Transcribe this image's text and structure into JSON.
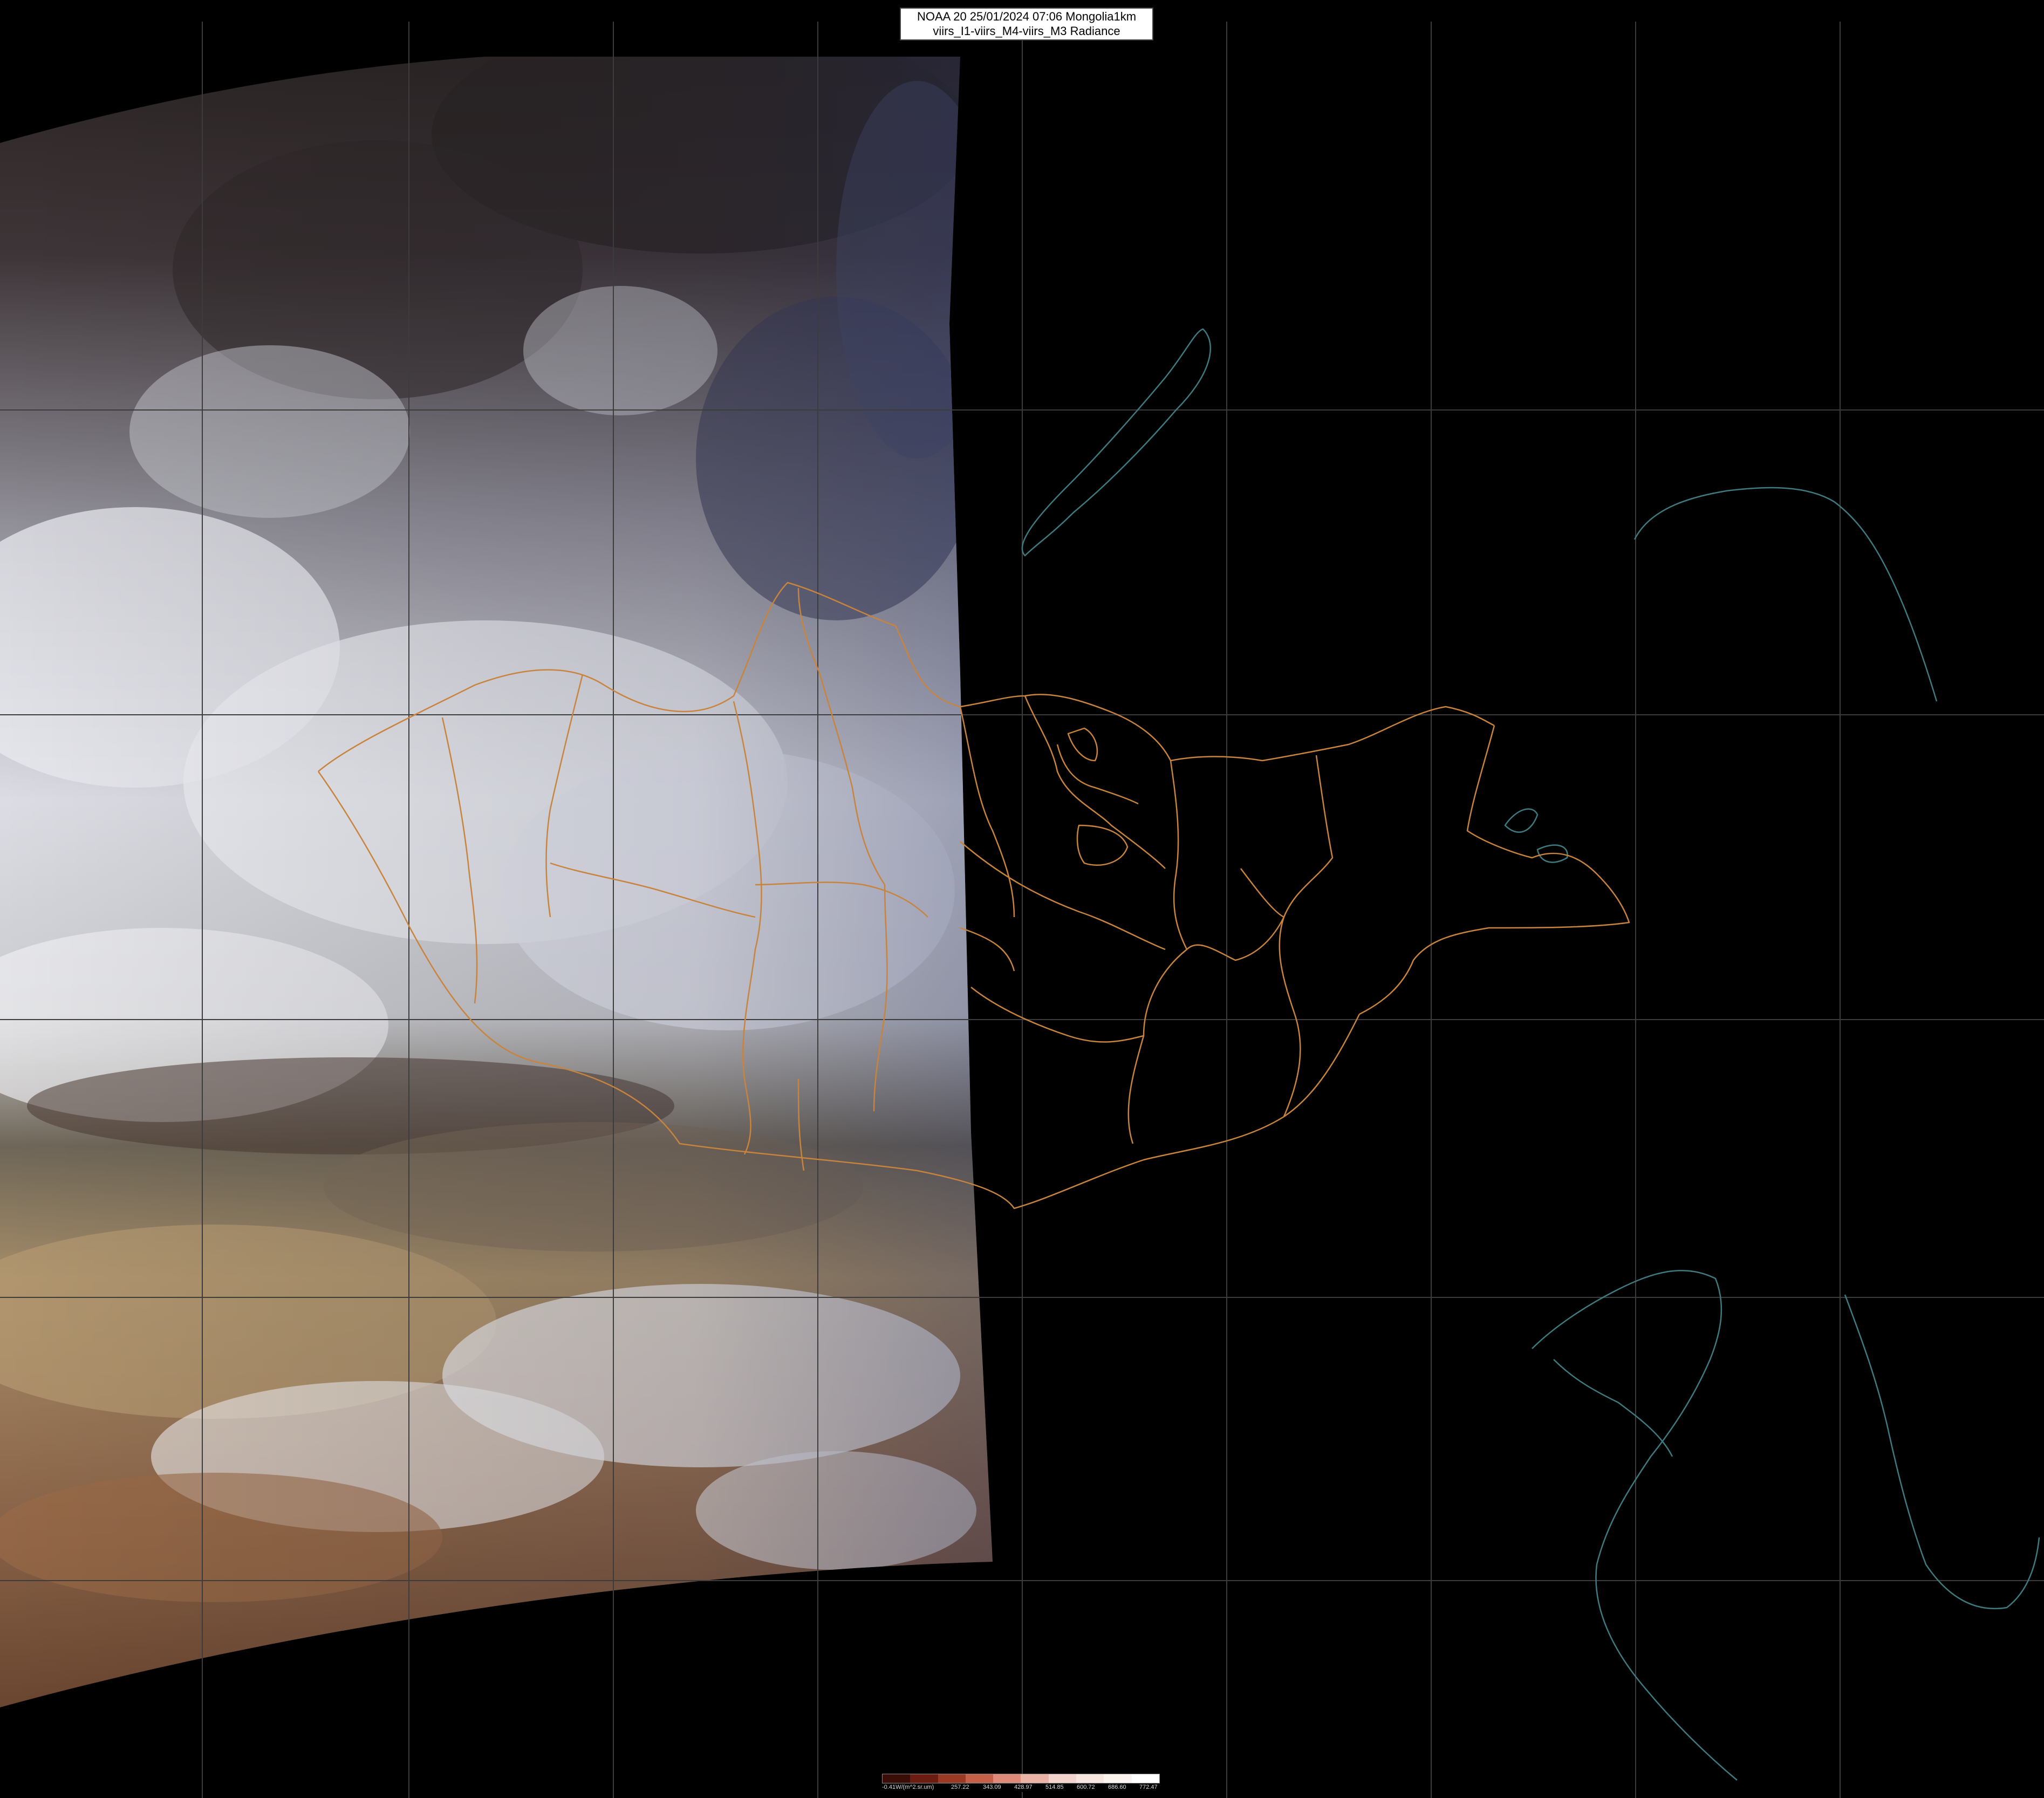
{
  "title": {
    "line1": "NOAA 20 25/01/2024 07:06 Mongolia1km",
    "line2": "viirs_I1-viirs_M4-viirs_M3 Radiance"
  },
  "legend": {
    "unit_label": "-0.41W/(m^2.sr.um)",
    "ticks": [
      "257.22",
      "343.09",
      "428.97",
      "514.85",
      "600.72",
      "686.60",
      "772.47"
    ],
    "colors": [
      "#3a0e06",
      "#6a1d10",
      "#9a3a25",
      "#c4604a",
      "#dd8a78",
      "#eab3a6",
      "#f3d4cc",
      "#f7e6e0",
      "#fbf3ef",
      "#ffffff"
    ]
  },
  "colors": {
    "background": "#000000",
    "grid": "#3c3c3c",
    "province_borders": "#c8843c",
    "coastline": "#3f7a80"
  }
}
